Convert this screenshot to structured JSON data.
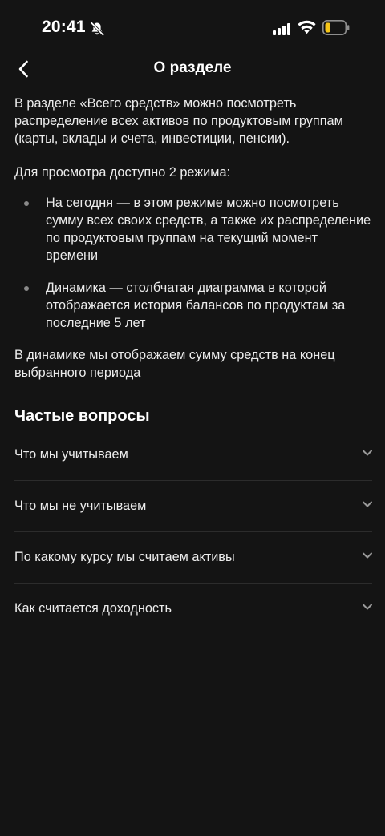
{
  "status_bar": {
    "time": "20:41",
    "icons": [
      "bell-slash-icon",
      "signal-icon",
      "wifi-icon",
      "battery-icon"
    ]
  },
  "header": {
    "back_icon": "chevron-left-icon",
    "title": "О разделе"
  },
  "content": {
    "intro": "В разделе «Всего средств» можно посмотреть распределение всех активов по продуктовым группам (карты, вклады и счета, инвестиции, пенсии).",
    "modes_title": "Для просмотра доступно 2 режима:",
    "modes": [
      {
        "text": "На сегодня — в этом режиме можно посмотреть сумму всех своих средств, а также их распределение по продуктовым группам на текущий момент времени"
      },
      {
        "text": "Динамика — столбчатая диаграмма в которой отображается история балансов по продуктам за последние 5 лет"
      }
    ],
    "outro": "В динамике мы отображаем сумму средств на конец выбранного периода"
  },
  "faq": {
    "title": "Частые вопросы",
    "items": [
      {
        "label": "Что мы учитываем"
      },
      {
        "label": "Что мы не учитываем"
      },
      {
        "label": "По какому курсу мы считаем активы"
      },
      {
        "label": "Как считается доходность"
      }
    ]
  },
  "colors": {
    "background": "#141414",
    "text": "#ececec",
    "divider": "#2c2c2c",
    "battery_low": "#f5c518"
  }
}
